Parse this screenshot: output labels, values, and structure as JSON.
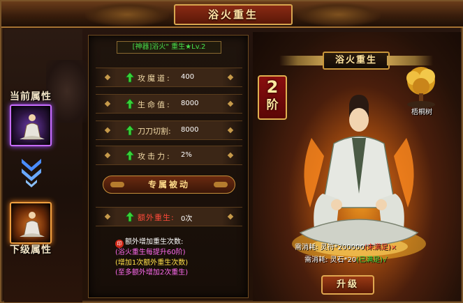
{
  "window": {
    "title": "浴火重生"
  },
  "left": {
    "current_label": "当前属性",
    "next_label": "下级属性"
  },
  "attributes": {
    "item_name": "[神器]浴火\" 重生★Lv.2",
    "rows": [
      {
        "label": "攻魔道:",
        "value": "400",
        "icon": "up-arrow-icon"
      },
      {
        "label": "生命值:",
        "value": "8000",
        "icon": "up-arrow-icon"
      },
      {
        "label": "刀刀切割:",
        "value": "8000",
        "icon": "up-arrow-icon"
      },
      {
        "label": "攻击力:",
        "value": "2%",
        "icon": "up-arrow-icon"
      }
    ],
    "section_title": "专属被动",
    "passive": {
      "label": "额外重生:",
      "value": "0次",
      "icon": "up-arrow-icon"
    },
    "notes": {
      "head": "额外增加重生次数:",
      "lines": [
        "(浴火重生每提升60阶)",
        "(增加1次额外重生次数)",
        "(至多额外增加2次重生)"
      ]
    }
  },
  "display": {
    "banner_title": "浴火重生",
    "stage_number": "2",
    "stage_unit": "阶",
    "tree_label": "梧桐树",
    "costs": [
      {
        "prefix": "需消耗: 灵符*200000",
        "status": "(未满足)",
        "mark": "×",
        "satisfied": false
      },
      {
        "prefix": "需消耗: 灵石*20",
        "status": "(已满足)",
        "mark": "√",
        "satisfied": true
      }
    ],
    "upgrade_label": "升级"
  },
  "colors": {
    "accent_gold": "#c8963a",
    "value_green": "#49e04a",
    "warning_red": "#ff4a3a",
    "note_pink": "#ff6bf0",
    "note_yellow": "#ffe04a"
  }
}
